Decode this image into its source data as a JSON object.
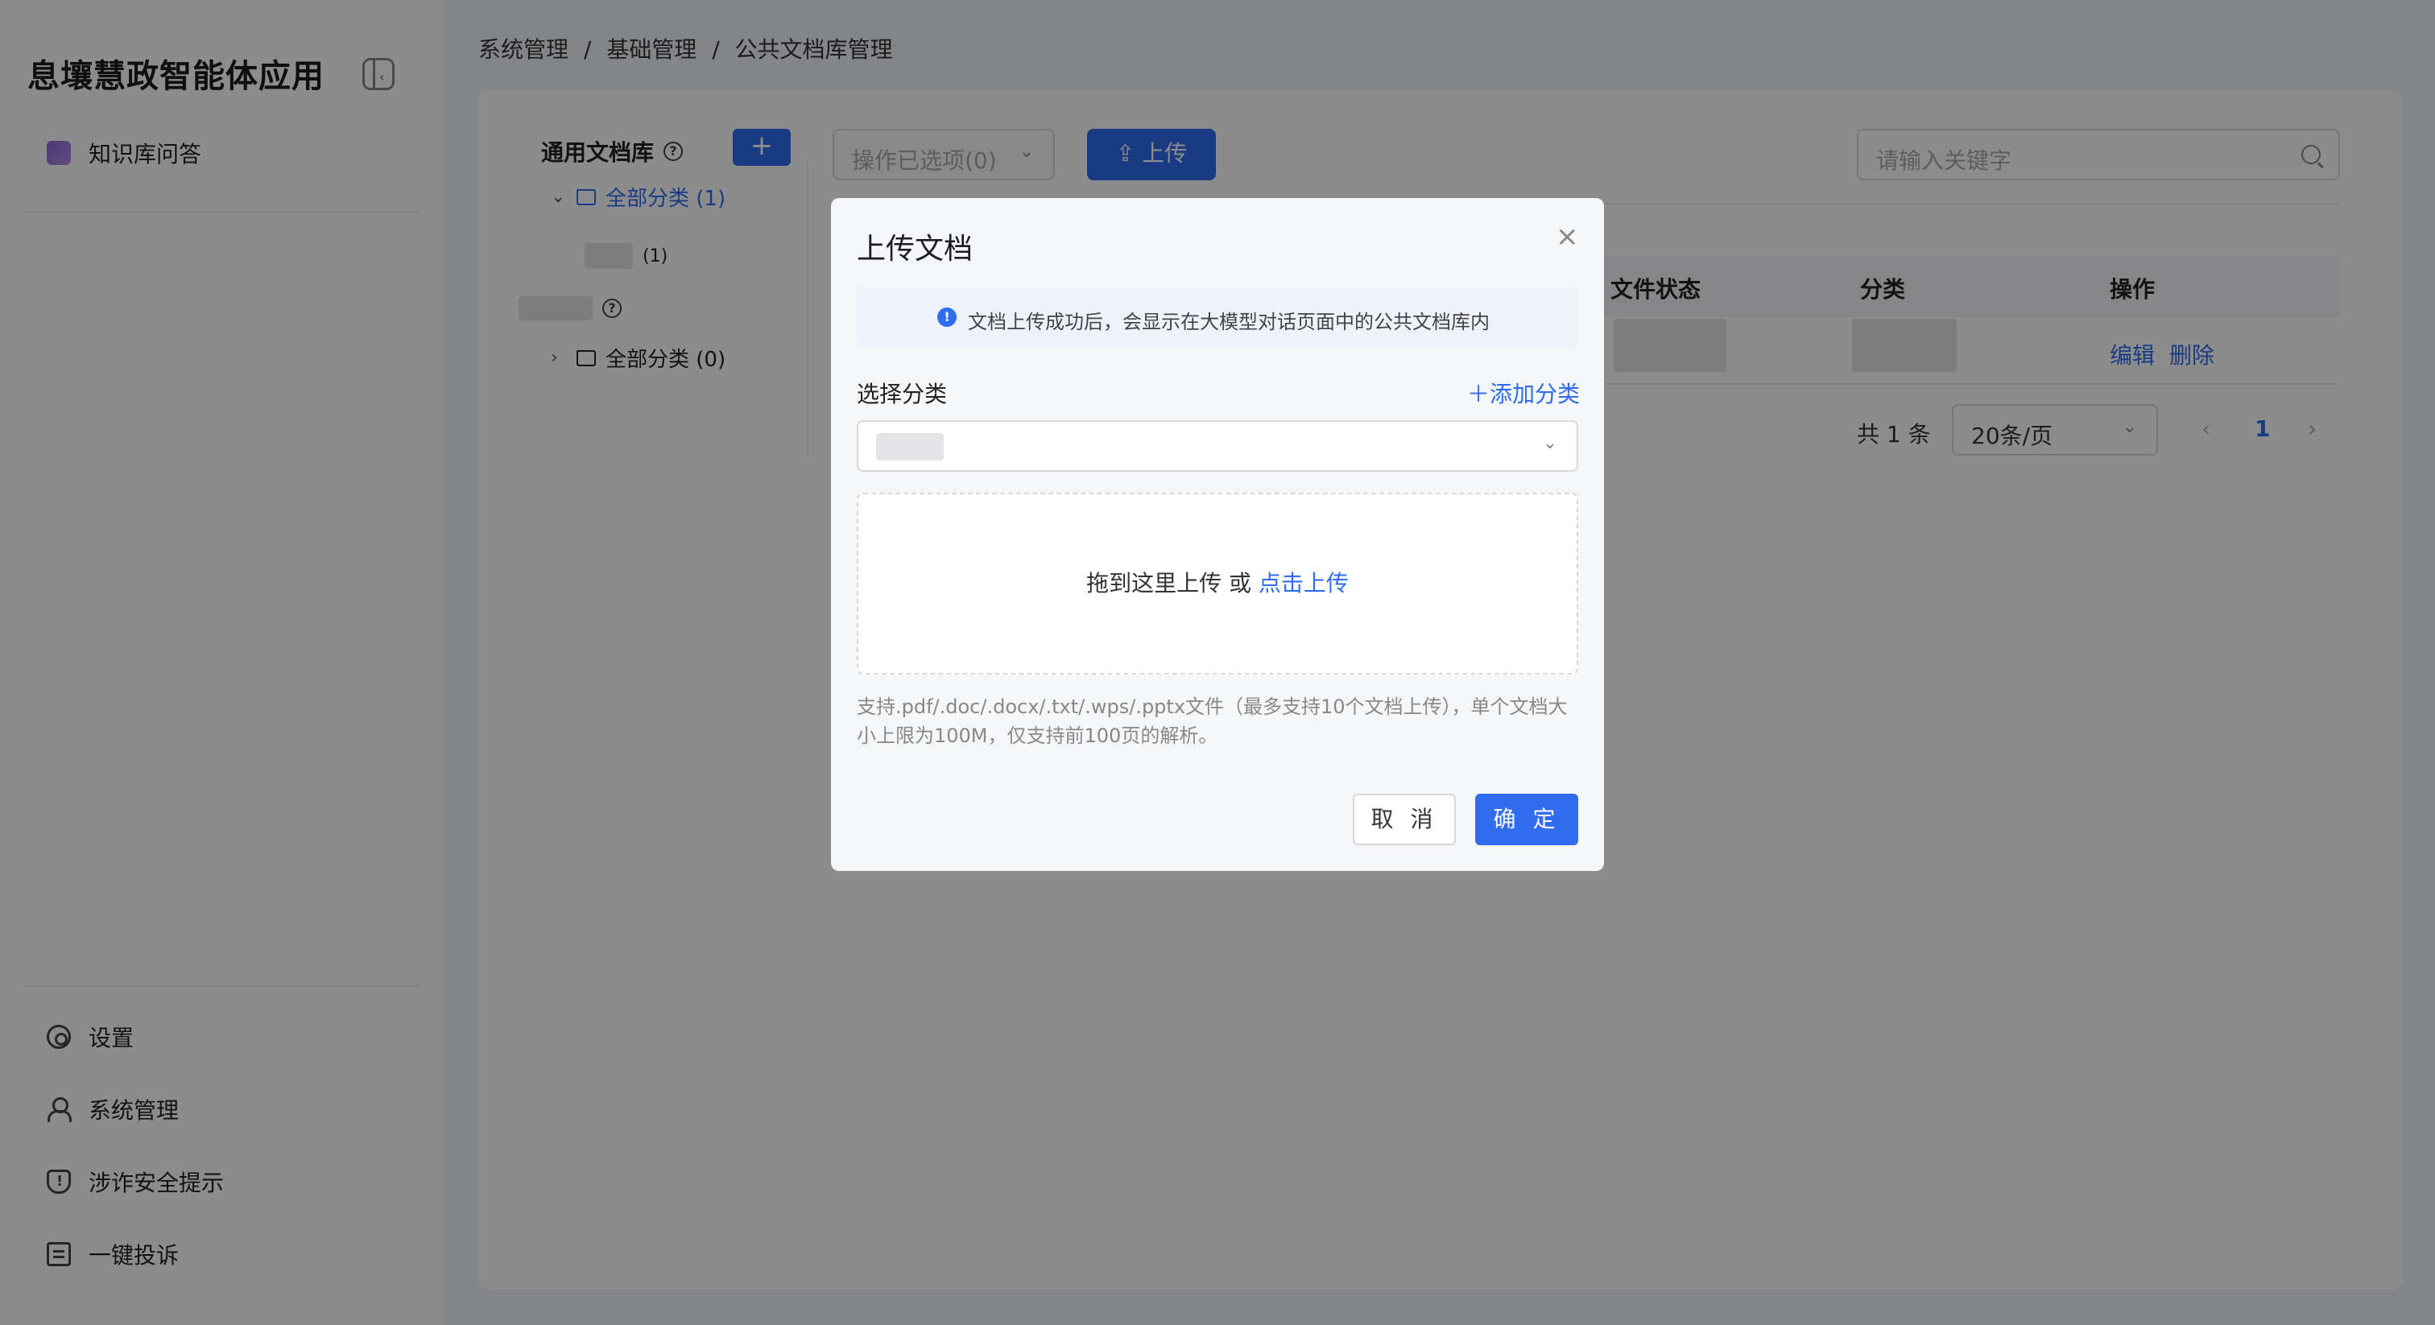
{
  "app": {
    "title": "息壤慧政智能体应用"
  },
  "sidebar": {
    "top_item": "知识库问答",
    "bottom_items": [
      {
        "label": "设置",
        "icon": "settings-icon"
      },
      {
        "label": "系统管理",
        "icon": "user-icon"
      },
      {
        "label": "涉诈安全提示",
        "icon": "shield-icon"
      },
      {
        "label": "一键投诉",
        "icon": "complain-icon"
      }
    ]
  },
  "breadcrumb": [
    "系统管理",
    "/",
    "基础管理",
    "/",
    "公共文档库管理"
  ],
  "library": {
    "title": "通用文档库",
    "add_label": "+",
    "tree": [
      {
        "label": "全部分类 (1)",
        "expanded": true
      },
      {
        "label": "(1)"
      },
      {
        "label": "全部分类 (0)",
        "expanded": false
      }
    ]
  },
  "toolbar": {
    "op_select": "操作已选项(0)",
    "upload_label": "上传",
    "search_placeholder": "请输入关键字"
  },
  "table": {
    "columns": [
      "文件状态",
      "分类",
      "操作"
    ],
    "row_actions": [
      "编辑",
      "删除"
    ]
  },
  "pagination": {
    "total": "共 1 条",
    "page_size": "20条/页",
    "current": "1",
    "prev": "‹",
    "next": "›"
  },
  "modal": {
    "title": "上传文档",
    "close": "×",
    "info": "文档上传成功后，会显示在大模型对话页面中的公共文档库内",
    "category_label": "选择分类",
    "add_category": "＋添加分类",
    "drop_text": "拖到这里上传 或 ",
    "drop_link": "点击上传",
    "hint": "支持.pdf/.doc/.docx/.txt/.wps/.pptx文件（最多支持10个文档上传），单个文档大小上限为100M，仅支持前100页的解析。",
    "cancel": "取 消",
    "confirm": "确 定"
  },
  "colors": {
    "accent": "#2f6cf0",
    "overlay": "rgba(0,0,0,0.45)"
  }
}
